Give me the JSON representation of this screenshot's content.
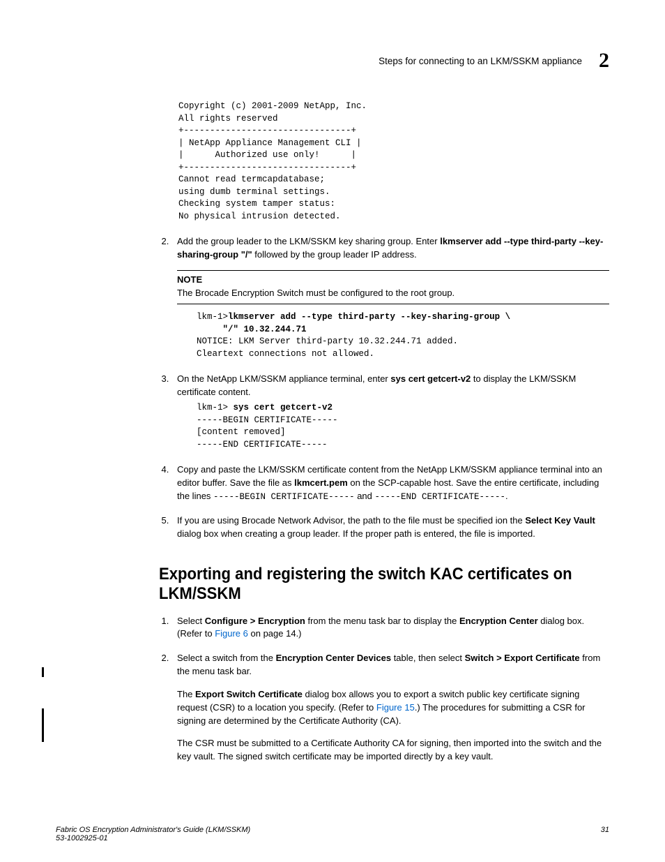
{
  "header": {
    "title": "Steps for connecting to an LKM/SSKM appliance",
    "chapter": "2"
  },
  "code1": "Copyright (c) 2001-2009 NetApp, Inc.\nAll rights reserved\n+--------------------------------+\n| NetApp Appliance Management CLI |\n|      Authorized use only!      |\n+--------------------------------+\nCannot read termcapdatabase;\nusing dumb terminal settings.\nChecking system tamper status:\nNo physical intrusion detected.",
  "step2": {
    "pre": "Add the group leader to the LKM/SSKM key sharing group. Enter ",
    "cmd1": "lkmserver add --type third-party --key-sharing-group \"/\"",
    "post": " followed by the group leader IP address."
  },
  "note": {
    "label": "NOTE",
    "text": "The Brocade Encryption Switch must be configured to the root group."
  },
  "code2_prefix": "lkm-1>",
  "code2_bold": "lkmserver add --type third-party --key-sharing-group \\\n     \"/\" 10.32.244.71",
  "code2_rest": "NOTICE: LKM Server third-party 10.32.244.71 added.\nCleartext connections not allowed.",
  "step3": {
    "pre": "On the NetApp LKM/SSKM appliance terminal, enter ",
    "cmd": "sys cert getcert-v2",
    "post": " to display the LKM/SSKM certificate content."
  },
  "code3_prefix": "lkm-1> ",
  "code3_bold": "sys cert getcert-v2",
  "code3_rest": "-----BEGIN CERTIFICATE-----\n[content removed]\n-----END CERTIFICATE-----",
  "step4": {
    "t1": "Copy and paste the LKM/SSKM certificate content from the NetApp LKM/SSKM appliance terminal into an editor buffer. Save the file as ",
    "b1": "lkmcert.pem",
    "t2": " on the SCP-capable host. Save the entire certificate, including the lines ",
    "m1": "-----BEGIN CERTIFICATE-----",
    "t3": " and ",
    "m2": "-----END CERTIFICATE-----",
    "t4": "."
  },
  "step5": {
    "t1": "If you are using Brocade Network Advisor, the path to the file must be specified ion the ",
    "b1": "Select Key Vault",
    "t2": " dialog box when creating a group leader. If the proper path is entered, the file is imported."
  },
  "section_heading": "Exporting and registering the switch KAC certificates on LKM/SSKM",
  "sec_step1": {
    "t1": "Select ",
    "b1": "Configure > Encryption",
    "t2": " from the menu task bar to display the ",
    "b2": "Encryption Center",
    "t3": " dialog box. (Refer to ",
    "link": "Figure 6",
    "t4": " on page 14.)"
  },
  "sec_step2": {
    "t1": "Select a switch from the ",
    "b1": "Encryption Center Devices",
    "t2": " table, then select ",
    "b2": "Switch > Export Certificate",
    "t3": " from the menu task bar."
  },
  "para1": {
    "t1": "The ",
    "b1": "Export Switch Certificate",
    "t2": " dialog box allows you to export a switch public key certificate signing request (CSR) to a location you specify. (Refer to ",
    "link": "Figure 15",
    "t3": ".) The procedures for submitting a CSR for signing are determined by the Certificate Authority (CA)."
  },
  "para2": "The CSR must be submitted to a Certificate Authority CA for signing, then imported into the switch and the key vault. The signed switch certificate may be imported directly by a key vault.",
  "footer": {
    "left1": "Fabric OS Encryption Administrator's Guide  (LKM/SSKM)",
    "left2": "53-1002925-01",
    "right": "31"
  }
}
